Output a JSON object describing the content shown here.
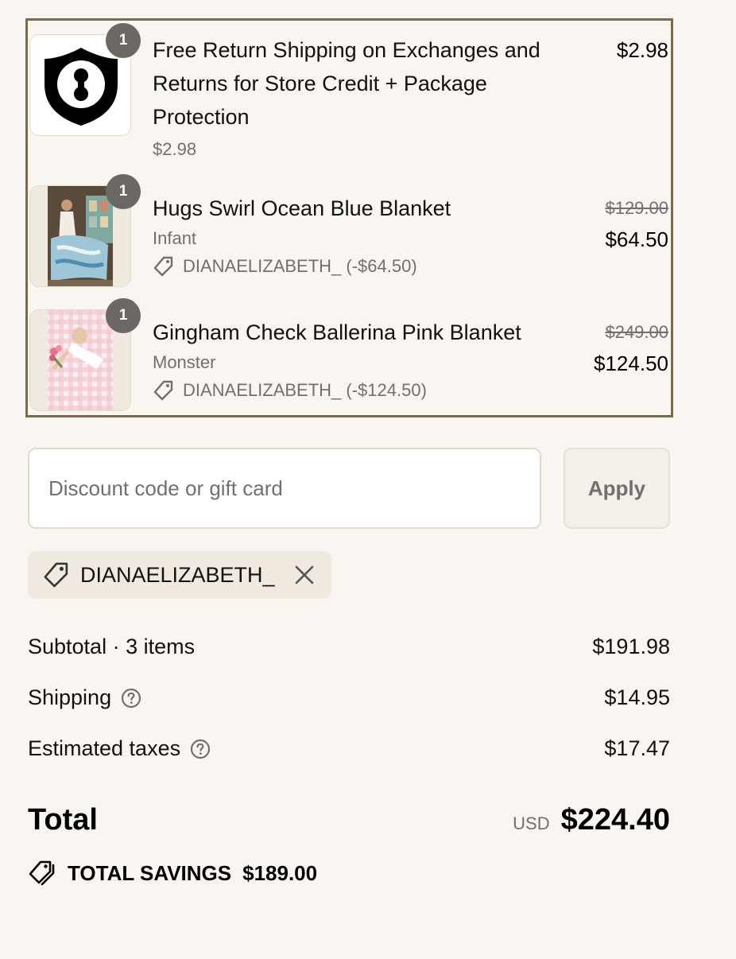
{
  "items": [
    {
      "title_line1": "Free Return Shipping on Exchanges and",
      "title_line2": "Returns for Store Credit + Package",
      "title_line3": "Protection",
      "sub_price": "$2.98",
      "price": "$2.98",
      "qty": "1",
      "image": "shield-keyhole-logo"
    },
    {
      "title": "Hugs Swirl Ocean Blue Blanket",
      "variant": "Infant",
      "discount": "DIANAELIZABETH_ (-$64.50)",
      "original_price": "$129.00",
      "price": "$64.50",
      "qty": "1",
      "image": "blanket-photo-blue"
    },
    {
      "title": "Gingham Check Ballerina Pink Blanket",
      "variant": "Monster",
      "discount": "DIANAELIZABETH_ (-$124.50)",
      "original_price": "$249.00",
      "price": "$124.50",
      "qty": "1",
      "image": "blanket-photo-pink"
    }
  ],
  "discount_input": {
    "placeholder": "Discount code or gift card",
    "value": ""
  },
  "apply_button": "Apply",
  "applied_code": "DIANAELIZABETH_",
  "summary": {
    "subtotal_label": "Subtotal · 3 items",
    "subtotal_value": "$191.98",
    "shipping_label": "Shipping",
    "shipping_value": "$14.95",
    "taxes_label": "Estimated taxes",
    "taxes_value": "$17.47"
  },
  "total": {
    "label": "Total",
    "currency": "USD",
    "amount": "$224.40"
  },
  "savings": {
    "label": "TOTAL SAVINGS",
    "amount": "$189.00"
  },
  "colors": {
    "background": "#f9f6f1",
    "border_accent": "#7b6a52",
    "muted_text": "#707070",
    "badge": "#6b6762",
    "chip_bg": "#efe9df"
  }
}
